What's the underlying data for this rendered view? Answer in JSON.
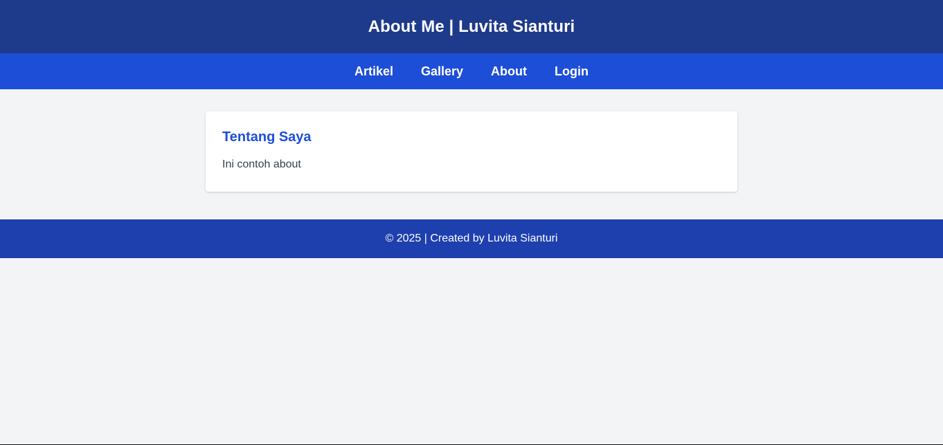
{
  "header": {
    "title": "About Me | Luvita Sianturi"
  },
  "nav": {
    "items": [
      {
        "label": "Artikel"
      },
      {
        "label": "Gallery"
      },
      {
        "label": "About"
      },
      {
        "label": "Login"
      }
    ]
  },
  "main": {
    "card": {
      "title": "Tentang Saya",
      "body": "Ini contoh about"
    }
  },
  "footer": {
    "text": "© 2025 | Created by Luvita Sianturi"
  },
  "colors": {
    "header_bg": "#1e3a8a",
    "nav_bg": "#1d4ed8",
    "footer_bg": "#1e40af",
    "accent_title": "#1d4ed8",
    "page_bg": "#f3f4f6"
  }
}
